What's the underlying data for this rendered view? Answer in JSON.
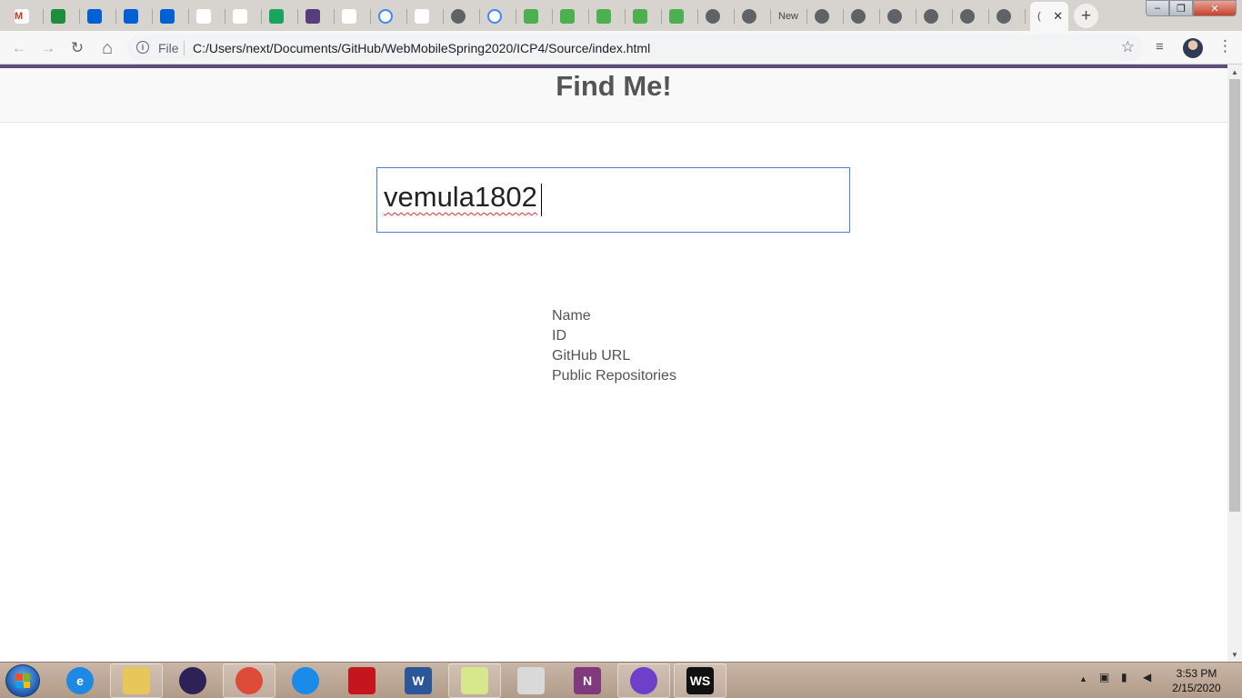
{
  "browser": {
    "tabs": [
      {
        "title": "M",
        "icon": "gmail-icon",
        "color": "#ffffff",
        "fg": "#d93025"
      },
      {
        "title": "",
        "icon": "sheets-icon",
        "color": "#1e8e3e",
        "fg": "#ffffff"
      },
      {
        "title": "",
        "icon": "box-icon",
        "color": "#0061d5",
        "fg": "#ffffff"
      },
      {
        "title": "",
        "icon": "box-icon",
        "color": "#0061d5",
        "fg": "#ffffff"
      },
      {
        "title": "",
        "icon": "box-icon",
        "color": "#0061d5",
        "fg": "#ffffff"
      },
      {
        "title": "",
        "icon": "codepen-icon",
        "color": "#ffffff",
        "fg": "#111111"
      },
      {
        "title": "",
        "icon": "github-icon",
        "color": "#ffffff",
        "fg": "#111111"
      },
      {
        "title": "",
        "icon": "green-circle-icon",
        "color": "#1aa260",
        "fg": "#ffffff"
      },
      {
        "title": "",
        "icon": "bootstrap-icon",
        "color": "#563d7c",
        "fg": "#ffffff"
      },
      {
        "title": "",
        "icon": "wave-icon",
        "color": "#ffffff",
        "fg": "#2c6fbb"
      },
      {
        "title": "",
        "icon": "google-icon",
        "color": "#ffffff",
        "fg": "#4285f4"
      },
      {
        "title": "",
        "icon": "link-icon",
        "color": "#ffffff",
        "fg": "#333333"
      },
      {
        "title": "",
        "icon": "globe-icon",
        "color": "#ffffff",
        "fg": "#5f6368"
      },
      {
        "title": "",
        "icon": "google-icon",
        "color": "#ffffff",
        "fg": "#4285f4"
      },
      {
        "title": "",
        "icon": "w3schools-icon",
        "color": "#4caf50",
        "fg": "#ffffff"
      },
      {
        "title": "",
        "icon": "w3schools-icon",
        "color": "#4caf50",
        "fg": "#ffffff"
      },
      {
        "title": "",
        "icon": "w3schools-icon",
        "color": "#4caf50",
        "fg": "#ffffff"
      },
      {
        "title": "",
        "icon": "w3schools-icon",
        "color": "#4caf50",
        "fg": "#ffffff"
      },
      {
        "title": "",
        "icon": "w3schools-icon",
        "color": "#4caf50",
        "fg": "#ffffff"
      },
      {
        "title": "",
        "icon": "globe-icon",
        "color": "#ffffff",
        "fg": "#5f6368"
      },
      {
        "title": "",
        "icon": "globe-icon",
        "color": "#ffffff",
        "fg": "#5f6368"
      },
      {
        "title": "New",
        "icon": "",
        "color": "",
        "fg": "#5f6368"
      },
      {
        "title": "",
        "icon": "globe-icon",
        "color": "#ffffff",
        "fg": "#5f6368"
      },
      {
        "title": "",
        "icon": "globe-icon",
        "color": "#ffffff",
        "fg": "#5f6368"
      },
      {
        "title": "",
        "icon": "globe-icon",
        "color": "#ffffff",
        "fg": "#5f6368"
      },
      {
        "title": "",
        "icon": "globe-icon",
        "color": "#ffffff",
        "fg": "#5f6368"
      },
      {
        "title": "",
        "icon": "globe-icon",
        "color": "#ffffff",
        "fg": "#5f6368"
      },
      {
        "title": "",
        "icon": "globe-icon",
        "color": "#ffffff",
        "fg": "#5f6368"
      }
    ],
    "active_tab": {
      "title": "(",
      "close": "✕"
    },
    "new_tab": "+",
    "window_controls": {
      "minimize": "‒",
      "maximize": "❐",
      "close": "✕"
    },
    "nav": {
      "back": "←",
      "forward": "→",
      "reload": "↻",
      "home": "⌂"
    },
    "address": {
      "scheme_label": "File",
      "url": "C:/Users/next/Documents/GitHub/WebMobileSpring2020/ICP4/Source/index.html",
      "info_icon": "i",
      "bookmark_star": "☆"
    },
    "toolbar_right": {
      "media": "≡",
      "menu": "⋮"
    },
    "accent": "#5d4d7a"
  },
  "page": {
    "heading": "Find Me!",
    "search": {
      "value": "vemula1802"
    },
    "info_labels": [
      "Name",
      "ID",
      "GitHub URL",
      "Public Repositories"
    ]
  },
  "taskbar": {
    "apps": [
      {
        "name": "internet-explorer-icon",
        "glyph": "e",
        "color": "#1e88e5",
        "pinned": false
      },
      {
        "name": "file-explorer-icon",
        "glyph": "",
        "color": "#e8c65a",
        "pinned": true
      },
      {
        "name": "eclipse-icon",
        "glyph": "",
        "color": "#2c2255",
        "pinned": false
      },
      {
        "name": "chrome-icon",
        "glyph": "",
        "color": "#dd4b39",
        "pinned": true
      },
      {
        "name": "sync-icon",
        "glyph": "",
        "color": "#1a8be8",
        "pinned": false
      },
      {
        "name": "acrobat-icon",
        "glyph": "",
        "color": "#c4161c",
        "pinned": false
      },
      {
        "name": "word-icon",
        "glyph": "W",
        "color": "#2b579a",
        "pinned": false
      },
      {
        "name": "sticky-notes-icon",
        "glyph": "",
        "color": "#d7e78c",
        "pinned": true
      },
      {
        "name": "snipping-tool-icon",
        "glyph": "",
        "color": "#d9d9d9",
        "pinned": false
      },
      {
        "name": "onenote-icon",
        "glyph": "N",
        "color": "#80397b",
        "pinned": false
      },
      {
        "name": "github-desktop-icon",
        "glyph": "",
        "color": "#6e40c9",
        "pinned": true
      },
      {
        "name": "webstorm-icon",
        "glyph": "WS",
        "color": "#111111",
        "pinned": true
      }
    ],
    "tray": {
      "arrow": "▲",
      "time": "3:53 PM",
      "date": "2/15/2020"
    }
  }
}
